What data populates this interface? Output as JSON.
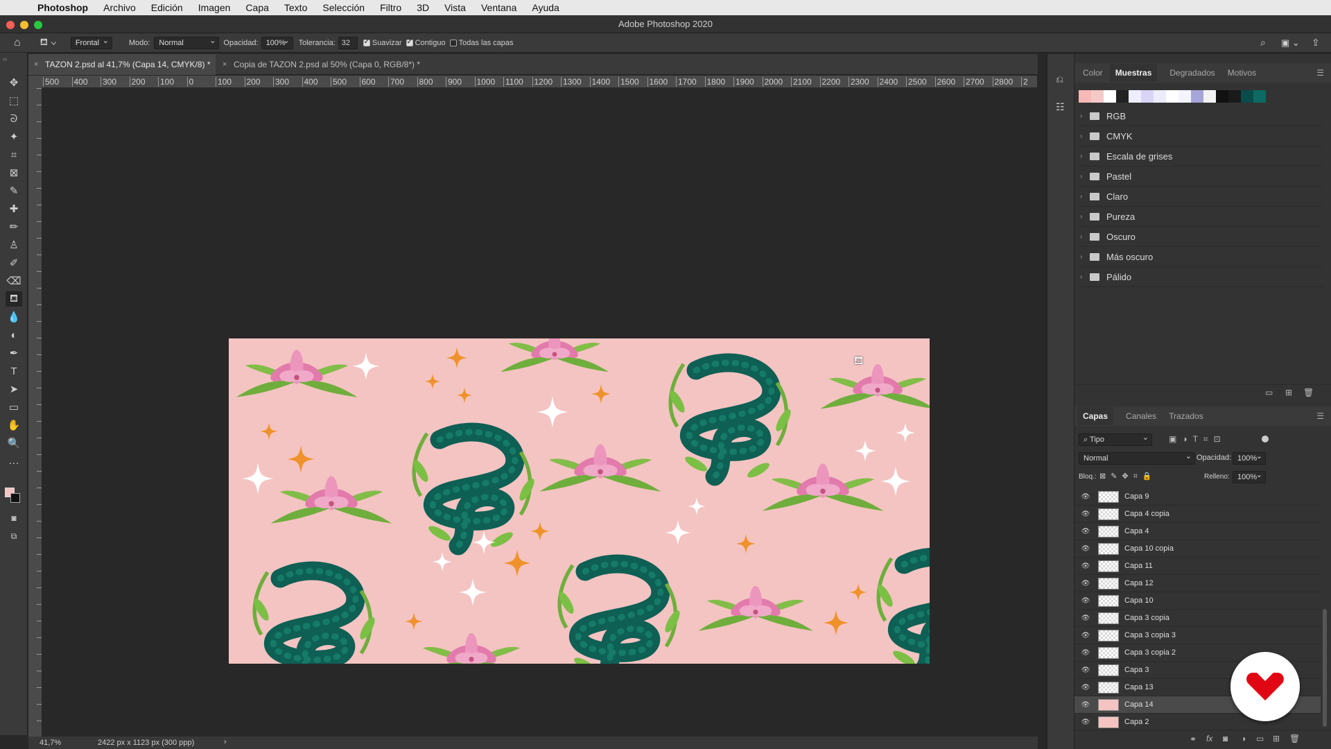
{
  "menubar": {
    "app": "Photoshop",
    "items": [
      "Archivo",
      "Edición",
      "Imagen",
      "Capa",
      "Texto",
      "Selección",
      "Filtro",
      "3D",
      "Vista",
      "Ventana",
      "Ayuda"
    ]
  },
  "window_title": "Adobe Photoshop 2020",
  "options": {
    "preset": "Frontal",
    "mode_label": "Modo:",
    "mode_value": "Normal",
    "opacity_label": "Opacidad:",
    "opacity_value": "100%",
    "tolerance_label": "Tolerancia:",
    "tolerance_value": "32",
    "smooth_label": "Suavizar",
    "contiguous_label": "Contiguo",
    "all_layers_label": "Todas las capas"
  },
  "tabs": [
    {
      "label": "TAZON 2.psd al 41,7% (Capa 14, CMYK/8) *",
      "close": "×"
    },
    {
      "label": "Copia de TAZON 2.psd al 50% (Capa 0, RGB/8*) *",
      "close": "×"
    }
  ],
  "ruler_marks": [
    "500",
    "400",
    "300",
    "200",
    "100",
    "0",
    "100",
    "200",
    "300",
    "400",
    "500",
    "600",
    "700",
    "800",
    "900",
    "1000",
    "1100",
    "1200",
    "1300",
    "1400",
    "1500",
    "1600",
    "1700",
    "1800",
    "1900",
    "2000",
    "2100",
    "2200",
    "2300",
    "2400",
    "2500",
    "2600",
    "2700",
    "2800",
    "2"
  ],
  "status": {
    "zoom": "41,7%",
    "doc_info": "2422 px x 1123 px (300 ppp)",
    "arrow": "›"
  },
  "swatches_panel": {
    "tabs": [
      "Color",
      "Muestras",
      "Degradados",
      "Motivos"
    ],
    "active_tab": "Muestras",
    "swatch_colors": [
      "#f7b8b8",
      "#f6c9c9",
      "#ffffff",
      "#222222",
      "#eeeeff",
      "#d9d4f6",
      "#ececfa",
      "#ffffff",
      "#f4f4ff",
      "#a7a4d9",
      "#f2f2f2",
      "#111111",
      "#1a1a1a",
      "#0a4b4b",
      "#0d6a62"
    ],
    "folders": [
      "RGB",
      "CMYK",
      "Escala de grises",
      "Pastel",
      "Claro",
      "Pureza",
      "Oscuro",
      "Más oscuro",
      "Pálido"
    ]
  },
  "layers_panel": {
    "tabs": [
      "Capas",
      "Canales",
      "Trazados"
    ],
    "active_tab": "Capas",
    "filter_label": "Tipo",
    "blend_mode": "Normal",
    "opacity_label": "Opacidad:",
    "opacity_value": "100%",
    "lock_label": "Bloq.:",
    "fill_label": "Relleno:",
    "fill_value": "100%",
    "layers": [
      {
        "name": "Capa 9",
        "thumb": "transparent",
        "selected": false
      },
      {
        "name": "Capa 4 copia",
        "thumb": "transparent",
        "selected": false
      },
      {
        "name": "Capa 4",
        "thumb": "transparent",
        "selected": false
      },
      {
        "name": "Capa 10 copia",
        "thumb": "transparent",
        "selected": false
      },
      {
        "name": "Capa 11",
        "thumb": "transparent",
        "selected": false
      },
      {
        "name": "Capa 12",
        "thumb": "transparent",
        "selected": false
      },
      {
        "name": "Capa 10",
        "thumb": "transparent",
        "selected": false
      },
      {
        "name": "Capa 3 copia",
        "thumb": "transparent",
        "selected": false
      },
      {
        "name": "Capa 3 copia 3",
        "thumb": "transparent",
        "selected": false
      },
      {
        "name": "Capa 3 copia 2",
        "thumb": "transparent",
        "selected": false
      },
      {
        "name": "Capa 3",
        "thumb": "transparent",
        "selected": false
      },
      {
        "name": "Capa 13",
        "thumb": "transparent",
        "selected": false
      },
      {
        "name": "Capa 14",
        "thumb": "pink",
        "selected": true
      },
      {
        "name": "Capa 2",
        "thumb": "pink",
        "selected": false
      }
    ]
  },
  "colors": {
    "canvas_bg": "#f4c4c2",
    "snake": "#0e5f54",
    "leaf": "#6fae3c",
    "flower": "#e483b0",
    "star_orange": "#f0922b",
    "star_white": "#ffffff",
    "logo_red": "#e10613"
  }
}
